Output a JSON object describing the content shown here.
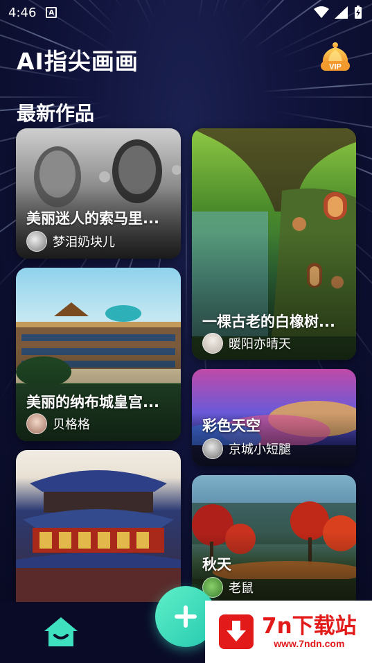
{
  "status_bar": {
    "time": "4:46",
    "notification_icon": "a-icon"
  },
  "header": {
    "app_title": "AI指尖画画",
    "vip_badge": "VIP"
  },
  "section": {
    "title": "最新作品"
  },
  "artworks": [
    {
      "title": "美丽迷人的索马里...",
      "author": "梦泪奶块儿"
    },
    {
      "title": "一棵古老的白橡树...",
      "author": "暖阳亦晴天"
    },
    {
      "title": "美丽的纳布城皇宫...",
      "author": "贝格格"
    },
    {
      "title": "彩色天空",
      "author": "京城小短腿"
    },
    {
      "title": "",
      "author": ""
    },
    {
      "title": "秋天",
      "author": "老鼠"
    }
  ],
  "bottom_nav": {
    "home_icon": "home-icon",
    "add_icon": "plus-icon"
  },
  "watermark": {
    "title": "7n下载站",
    "url": "www.7ndn.com"
  },
  "colors": {
    "accent": "#3ee0c0",
    "background": "#0b0d2a",
    "watermark_red": "#e21a1a"
  }
}
